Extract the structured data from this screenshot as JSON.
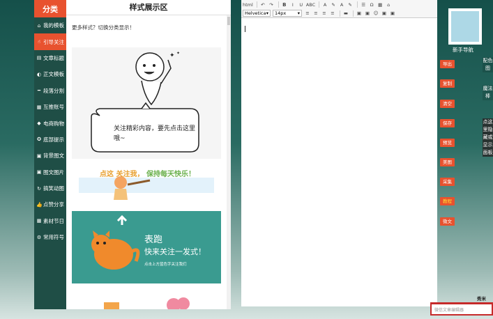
{
  "category": {
    "title": "分类",
    "items": [
      {
        "icon": "home-icon",
        "glyph": "⌂",
        "label": "我的模板"
      },
      {
        "icon": "thumbs-up-icon",
        "glyph": "☝",
        "label": "引导关注"
      },
      {
        "icon": "file-icon",
        "glyph": "▤",
        "label": "文章标题"
      },
      {
        "icon": "half-circle-icon",
        "glyph": "◐",
        "label": "正文模板"
      },
      {
        "icon": "minus-icon",
        "glyph": "━",
        "label": "段落分割"
      },
      {
        "icon": "grid-icon",
        "glyph": "▦",
        "label": "互推账号"
      },
      {
        "icon": "tag-icon",
        "glyph": "◆",
        "label": "电商购物"
      },
      {
        "icon": "compass-icon",
        "glyph": "✪",
        "label": "底部提示"
      },
      {
        "icon": "image-icon",
        "glyph": "▣",
        "label": "背景图文"
      },
      {
        "icon": "picture-icon",
        "glyph": "▣",
        "label": "图文图片"
      },
      {
        "icon": "refresh-icon",
        "glyph": "↻",
        "label": "搞笑动图"
      },
      {
        "icon": "like-icon",
        "glyph": "👍",
        "label": "点赞分享"
      },
      {
        "icon": "calendar-icon",
        "glyph": "▦",
        "label": "素材节日"
      },
      {
        "icon": "cogs-icon",
        "glyph": "⚙",
        "label": "常用符号"
      }
    ],
    "active_index": 1
  },
  "style_panel": {
    "title": "样式展示区",
    "more_link": "更多样式？切换分类显示！",
    "card1_text": "关注精彩内容，要先点击这里哦~",
    "card2_text_a": "点这",
    "card2_text_b": "关注我，",
    "card2_text_c": "保持每天快乐！",
    "card3_line1": "表跑",
    "card3_line2": "快来关注一发式！",
    "card3_line3": "点击上方蓝色字关注我们"
  },
  "editor": {
    "font_family": "Helvetica",
    "font_size": "14px",
    "toolbar_row1": [
      "html",
      "↶",
      "↷",
      "B",
      "I",
      "U",
      "ABC",
      "A",
      "✎",
      "A",
      "✎",
      "☰",
      "Ω",
      "▦",
      "⌂"
    ],
    "toolbar_row2": [
      "≡",
      "≡",
      "≡",
      "≡",
      "▬",
      "▣",
      "▣",
      "☺",
      "▣",
      "▣"
    ]
  },
  "sidebar": {
    "nav_label": "新手导航",
    "buttons": [
      "导出",
      "复制",
      "清空",
      "保存",
      "预览",
      "美图",
      "采集",
      "教程",
      "微文"
    ],
    "highlight_button": "教程",
    "vtab1": "配色图",
    "vtab2": "魔法棒",
    "vtab3": "点这里隐藏或显示面板"
  },
  "footer": {
    "brand": "秀米",
    "input_placeholder": "微信文章编辑器"
  },
  "colors": {
    "accent": "#e8522f",
    "sidebar_bg": "#1f4e46",
    "qr_fill": "#add8e6",
    "card_teal": "#3a9b90"
  }
}
